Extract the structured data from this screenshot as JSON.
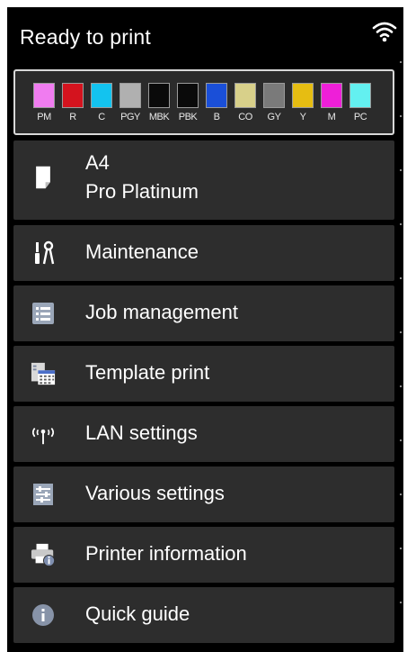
{
  "header": {
    "title": "Ready to print",
    "wifi_icon": "wifi-icon"
  },
  "ink_tanks": [
    {
      "label": "PM",
      "color": "#f07cf0"
    },
    {
      "label": "R",
      "color": "#d4131e"
    },
    {
      "label": "C",
      "color": "#13c3ef"
    },
    {
      "label": "PGY",
      "color": "#b0b0b0"
    },
    {
      "label": "MBK",
      "color": "#0a0a0a"
    },
    {
      "label": "PBK",
      "color": "#0a0a0a"
    },
    {
      "label": "B",
      "color": "#1a4fd8"
    },
    {
      "label": "CO",
      "color": "#d8d08a"
    },
    {
      "label": "GY",
      "color": "#7a7a7a"
    },
    {
      "label": "Y",
      "color": "#e6bd12"
    },
    {
      "label": "M",
      "color": "#ee1fd8"
    },
    {
      "label": "PC",
      "color": "#63f0f0"
    }
  ],
  "paper": {
    "size": "A4",
    "type": "Pro Platinum",
    "icon": "paper-icon"
  },
  "menu": [
    {
      "label": "Maintenance",
      "icon": "maintenance-icon"
    },
    {
      "label": "Job management",
      "icon": "job-list-icon"
    },
    {
      "label": "Template print",
      "icon": "template-icon"
    },
    {
      "label": "LAN settings",
      "icon": "lan-antenna-icon"
    },
    {
      "label": "Various settings",
      "icon": "settings-sliders-icon"
    },
    {
      "label": "Printer information",
      "icon": "printer-info-icon"
    },
    {
      "label": "Quick guide",
      "icon": "info-icon"
    }
  ]
}
